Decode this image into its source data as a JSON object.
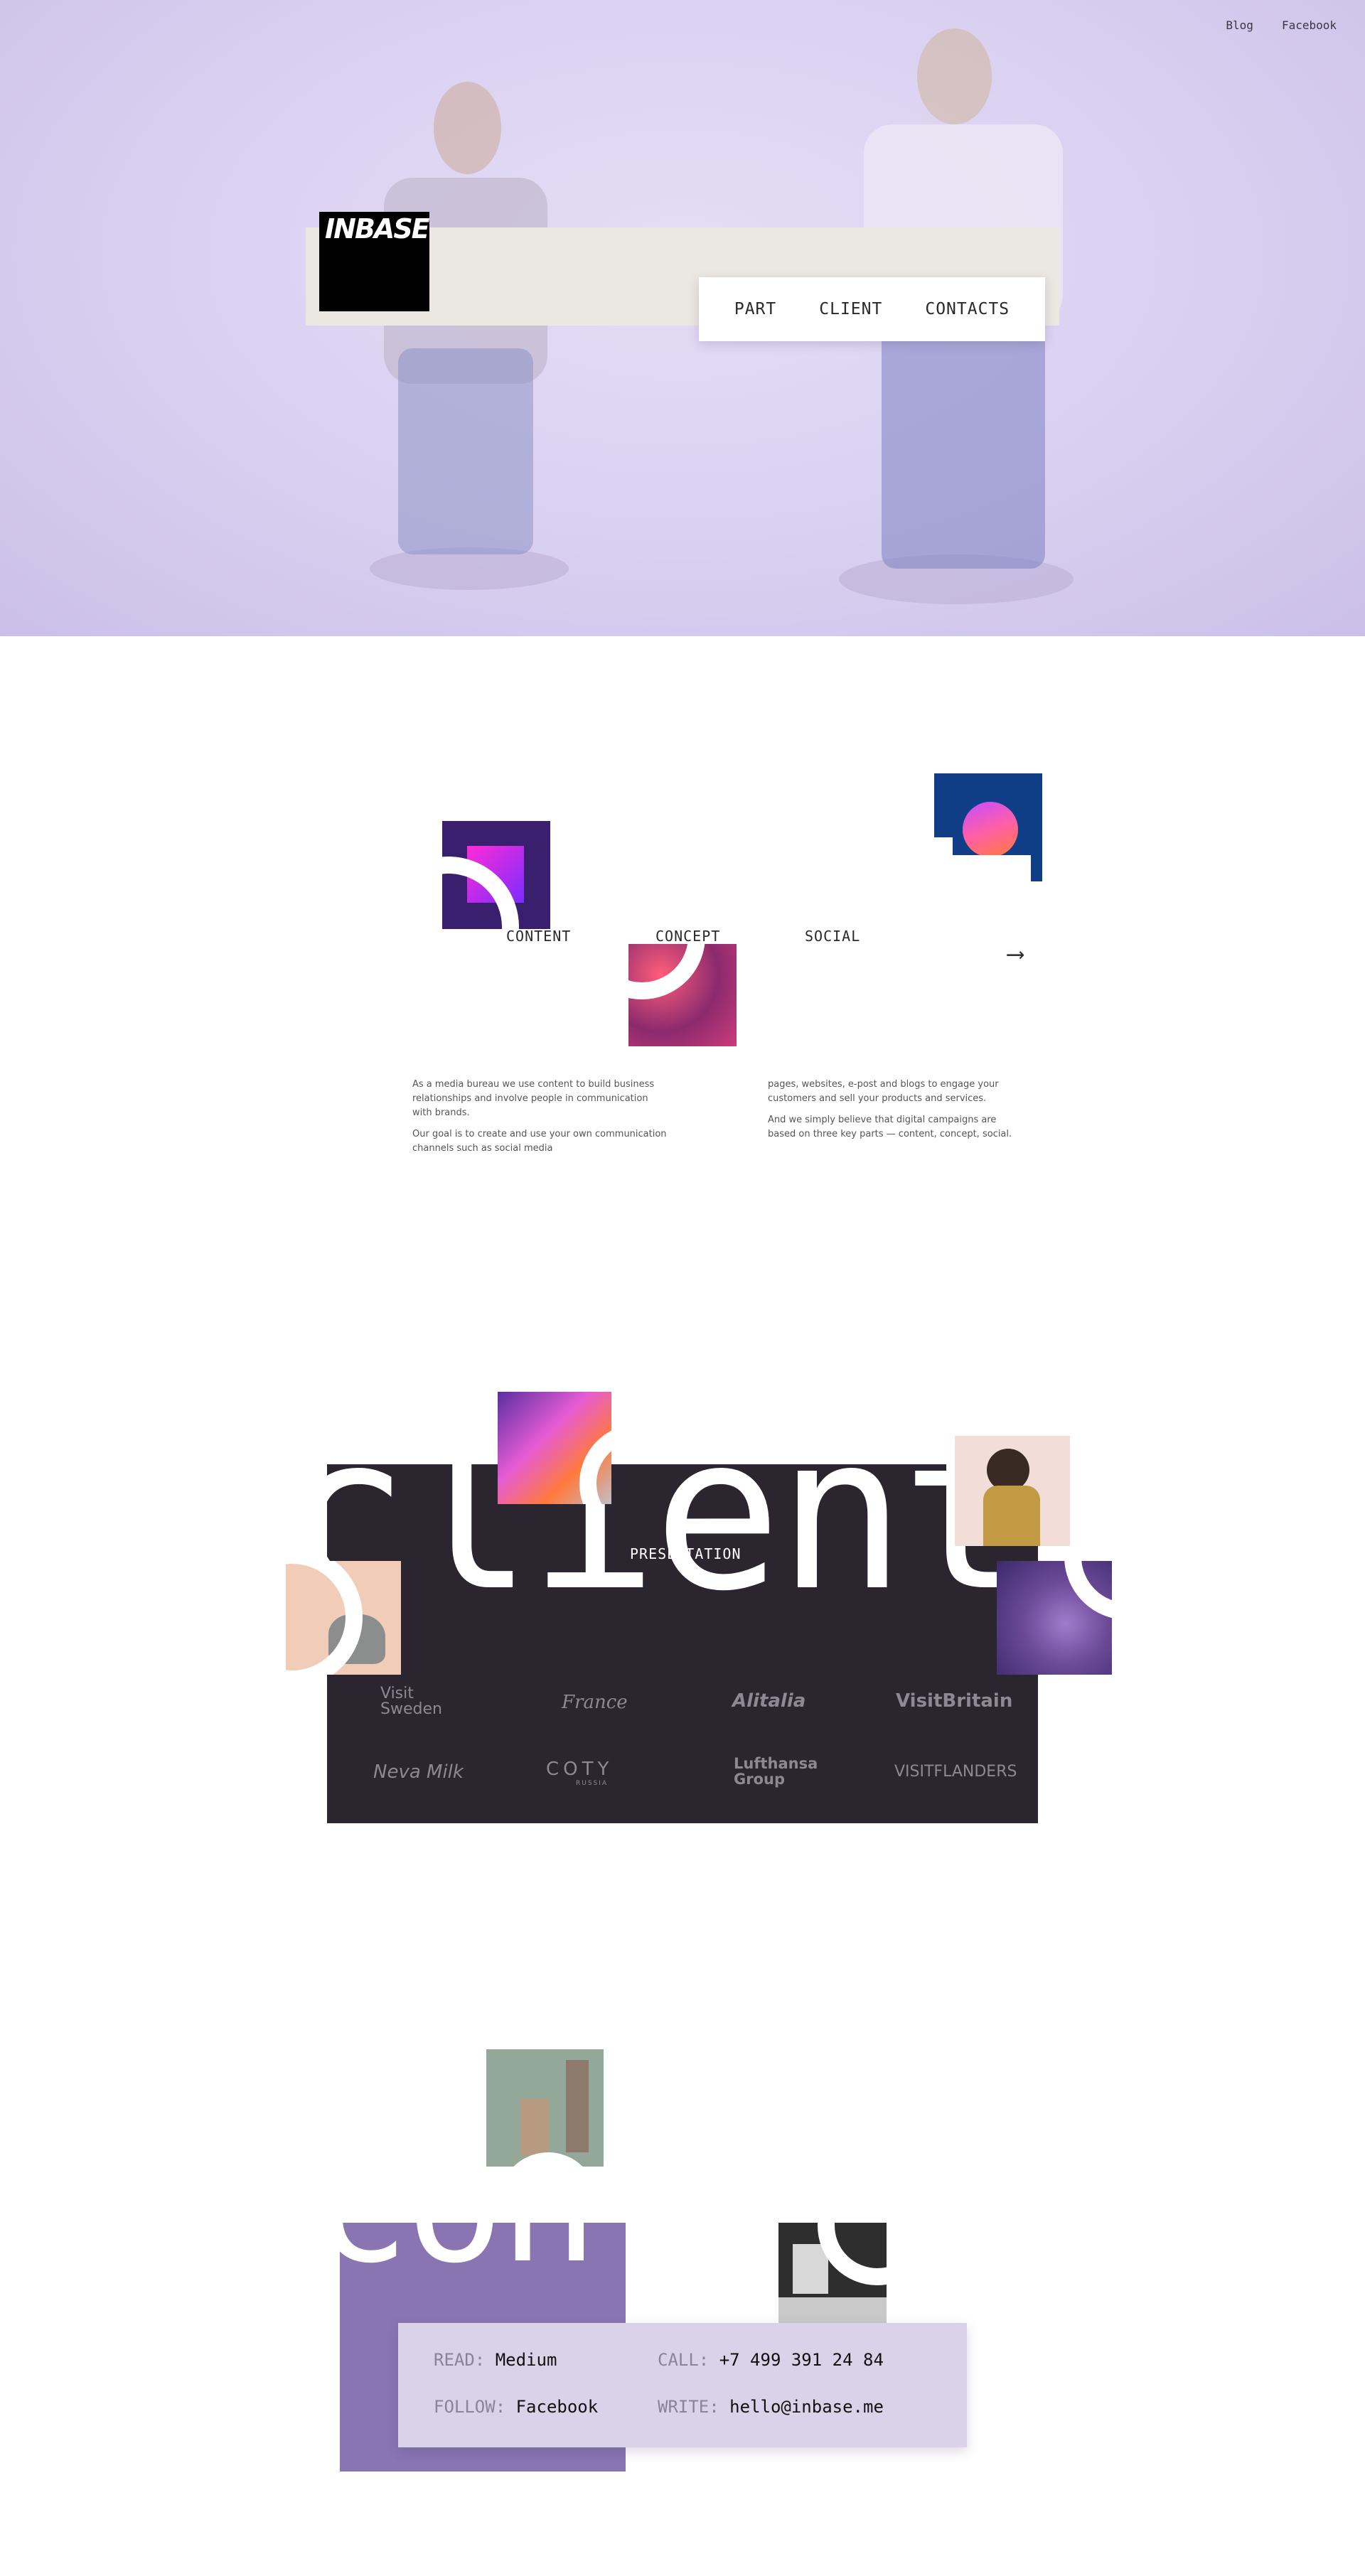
{
  "header": {
    "links": [
      "Blog",
      "Facebook"
    ],
    "logo_text": "INBASE",
    "menu": [
      "PART",
      "CLIENT",
      "CONTACTS"
    ]
  },
  "part": {
    "tabs": [
      "CONTENT",
      "CONCEPT",
      "SOCIAL"
    ],
    "arrow": "⟶",
    "left_paragraphs": [
      "As a media bureau we use content to build business relationships and involve people in communication with brands.",
      "Our goal is to create and use your own communication channels such as social media"
    ],
    "right_paragraphs": [
      "pages, websites, e-post and blogs to engage your customers and sell your products and services.",
      "And we simply believe that digital campaigns are based on three key parts — content, concept, social."
    ]
  },
  "client": {
    "big_word": "client",
    "label": "PRESENTATION",
    "brands": [
      "Visit Sweden",
      "France",
      "Alitalia",
      "VisitBritain",
      "Neva Milk",
      "COTY",
      "Lufthansa Group",
      "VISITFLANDERS"
    ],
    "brand_sub": {
      "coty": "RUSSIA"
    }
  },
  "contacts": {
    "big_word": "contacts",
    "read_label": "READ:",
    "read_value": "Medium",
    "call_label": "CALL:",
    "call_value": "+7 499 391 24 84",
    "follow_label": "FOLLOW:",
    "follow_value": "Facebook",
    "write_label": "WRITE:",
    "write_value": "hello@inbase.me"
  },
  "colors": {
    "hero_bg": "#d9d0f0",
    "bar": "#ebe7e1",
    "client_panel": "#2b252f",
    "contacts_panel": "#8875b1",
    "contact_card": "#d9d2e9"
  }
}
